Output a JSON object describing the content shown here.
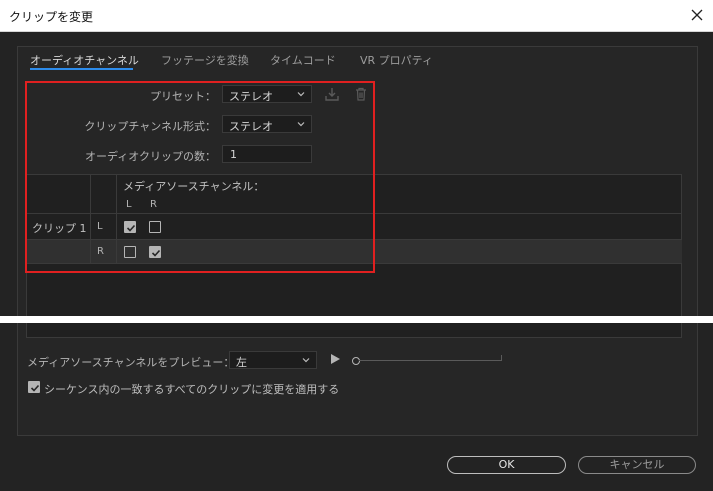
{
  "window": {
    "title": "クリップを変更"
  },
  "tabs": [
    "オーディオチャンネル",
    "フッテージを変換",
    "タイムコード",
    "VR プロパティ"
  ],
  "form": {
    "preset_label": "プリセット：",
    "preset_value": "ステレオ",
    "format_label": "クリップチャンネル形式：",
    "format_value": "ステレオ",
    "count_label": "オーディオクリップの数：",
    "count_value": "1"
  },
  "matrix": {
    "header": "メディアソースチャンネル：",
    "col_l": "L",
    "col_r": "R",
    "clip_label": "クリップ 1",
    "rows": [
      {
        "label": "L",
        "l_checked": true,
        "r_checked": false
      },
      {
        "label": "R",
        "l_checked": false,
        "r_checked": true
      }
    ]
  },
  "preview": {
    "label": "メディアソースチャンネルをプレビュー：",
    "value": "左"
  },
  "apply_all": {
    "label": "シーケンス内の一致するすべてのクリップに変更を適用する",
    "checked": true
  },
  "buttons": {
    "ok": "OK",
    "cancel": "キャンセル"
  }
}
